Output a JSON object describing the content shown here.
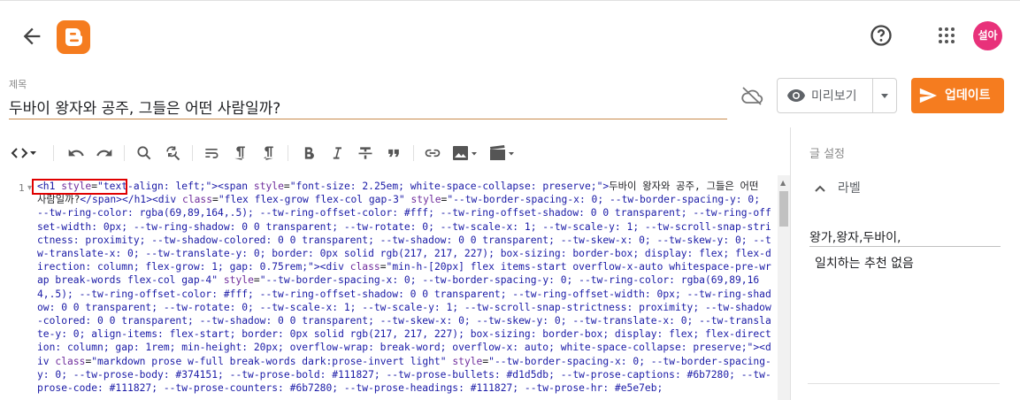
{
  "header": {
    "avatar_text": "설아"
  },
  "post": {
    "title_label": "제목",
    "title": "두바이 왕자와 공주, 그들은 어떤 사람일까?"
  },
  "actions": {
    "preview_label": "미리보기",
    "update_label": "업데이트",
    "brand_color": "#f57c1f"
  },
  "toolbar": {
    "icons": [
      "code-view-icon",
      "undo-icon",
      "redo-icon",
      "search-icon",
      "find-replace-icon",
      "wrap-icon",
      "ltr-icon",
      "rtl-icon",
      "bold-icon",
      "italic-icon",
      "strikethrough-icon",
      "quote-icon",
      "link-icon",
      "image-icon",
      "video-icon"
    ]
  },
  "editor": {
    "line_number": "1",
    "highlight_color": "#e00000"
  },
  "sidebar": {
    "title": "글 설정",
    "labels_title": "라벨",
    "labels_value": "왕가,왕자,두바이,",
    "no_match_text": "일치하는 추천 없음"
  }
}
